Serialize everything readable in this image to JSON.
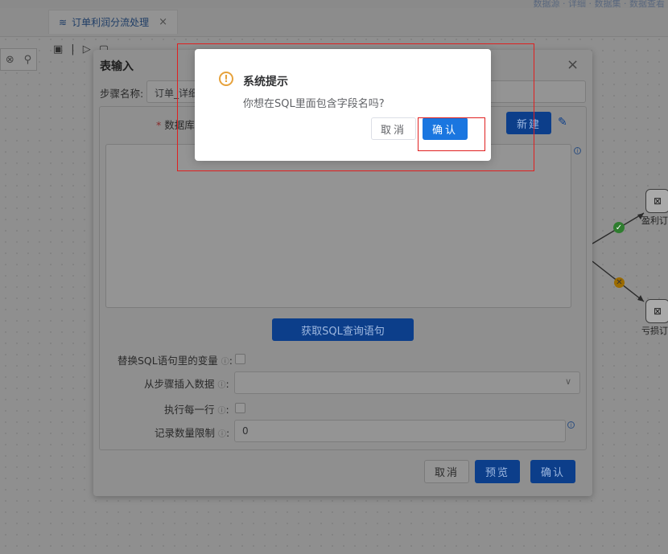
{
  "app": {
    "breadcrumbs": "数据源 · 详细 · 数据集 · 数据查看",
    "tab_title": "订单利润分流处理",
    "tab_close": "×",
    "search_icon_glyph": "⚲",
    "clear_icon_glyph": "⊗"
  },
  "canvas": {
    "node_profit_label": "盈利订",
    "node_loss_label": "亏损订",
    "node_icon_glyph": "⊠",
    "hop_ok_glyph": "✓",
    "hop_err_glyph": "✕"
  },
  "dialog": {
    "title": "表输入",
    "close": "×",
    "step_name_label": "步骤名称:",
    "step_name_value": "订单_详细",
    "db_label": "数据库",
    "required_mark": "*",
    "new_button": "新建",
    "get_sql_button": "获取SQL查询语句",
    "replace_vars_label": "替换SQL语句里的变量",
    "insert_from_step_label": "从步骤插入数据",
    "execute_each_row_label": "执行每一行",
    "limit_label": "记录数量限制",
    "limit_value": "0",
    "help_glyph": "?",
    "colon": ":",
    "footer": {
      "cancel": "取消",
      "preview": "预览",
      "confirm": "确认"
    }
  },
  "message_box": {
    "title": "系统提示",
    "text": "你想在SQL里面包含字段名吗?",
    "icon_glyph": "!",
    "cancel": "取消",
    "confirm": "确认"
  },
  "colors": {
    "primary": "#1a76e0",
    "warning": "#e6a23c",
    "highlight": "#e02020"
  }
}
